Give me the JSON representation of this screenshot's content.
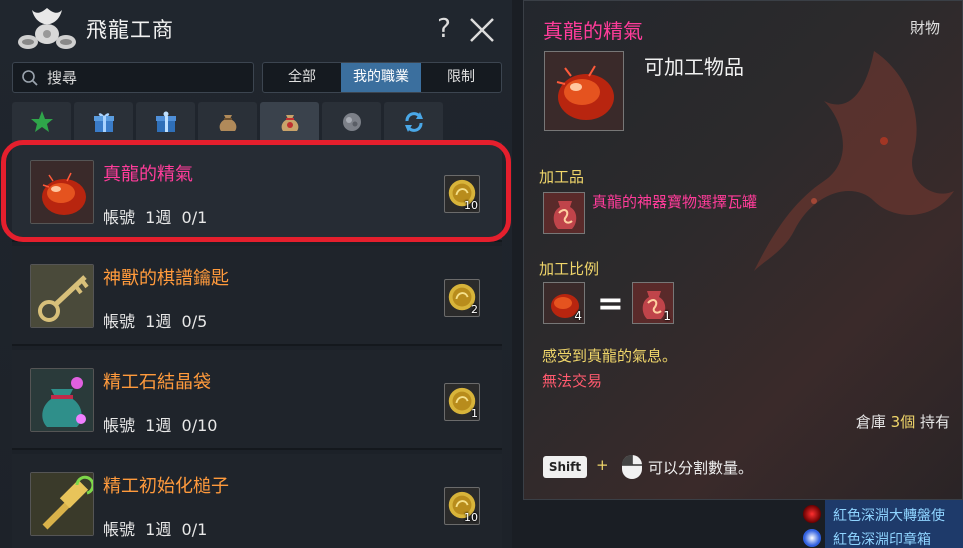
{
  "window": {
    "title": "飛龍工商",
    "help_label": "?"
  },
  "search": {
    "placeholder": "搜尋",
    "value": ""
  },
  "filters": [
    {
      "label": "全部",
      "active": false
    },
    {
      "label": "我的職業",
      "active": true
    },
    {
      "label": "限制",
      "active": false
    }
  ],
  "category_tabs": [
    {
      "icon": "star-icon"
    },
    {
      "icon": "gift-box-icon"
    },
    {
      "icon": "gift-box-alt-icon"
    },
    {
      "icon": "pouch-icon"
    },
    {
      "icon": "red-pouch-icon"
    },
    {
      "icon": "ore-icon"
    },
    {
      "icon": "refresh-icon"
    }
  ],
  "items": [
    {
      "name": "真龍的精氣",
      "limit": "帳號  1週  0/1",
      "cost": "10",
      "color": "#ff3c9a",
      "icon": "dragon-essence-icon",
      "selected": true
    },
    {
      "name": "神獸的棋譜鑰匙",
      "limit": "帳號  1週  0/5",
      "cost": "2",
      "color": "#ff9a3c",
      "icon": "key-icon",
      "selected": false
    },
    {
      "name": "精工石結晶袋",
      "limit": "帳號  1週  0/10",
      "cost": "1",
      "color": "#ff9a3c",
      "icon": "crystal-bag-icon",
      "selected": false
    },
    {
      "name": "精工初始化槌子",
      "limit": "帳號  1週  0/1",
      "cost": "10",
      "color": "#ff9a3c",
      "icon": "hammer-icon",
      "selected": false
    }
  ],
  "tooltip": {
    "title": "真龍的精氣",
    "type": "財物",
    "subtitle": "可加工物品",
    "product_label": "加工品",
    "product_name": "真龍的神器寶物選擇瓦罐",
    "ratio_label": "加工比例",
    "ratio_input": "4",
    "ratio_equals": "=",
    "ratio_output": "1",
    "description": "感受到真龍的氣息。",
    "trade": "無法交易",
    "storage_prefix": "倉庫 ",
    "storage_count": "3個",
    "storage_suffix": " 持有",
    "shift_key": "Shift",
    "plus": "+",
    "split_text": "可以分割數量。"
  },
  "notifications": [
    {
      "text": "紅色深淵大轉盤使",
      "icon": "red-orb-icon"
    },
    {
      "text": "紅色深淵印章箱",
      "icon": "seal-box-icon"
    }
  ],
  "colors": {
    "accent_blue": "#3b6f9e",
    "selection_red": "#e51f2d",
    "legendary_pink": "#ff3c9a",
    "epic_orange": "#ff9a3c",
    "tooltip_gold": "#f0d66a"
  }
}
